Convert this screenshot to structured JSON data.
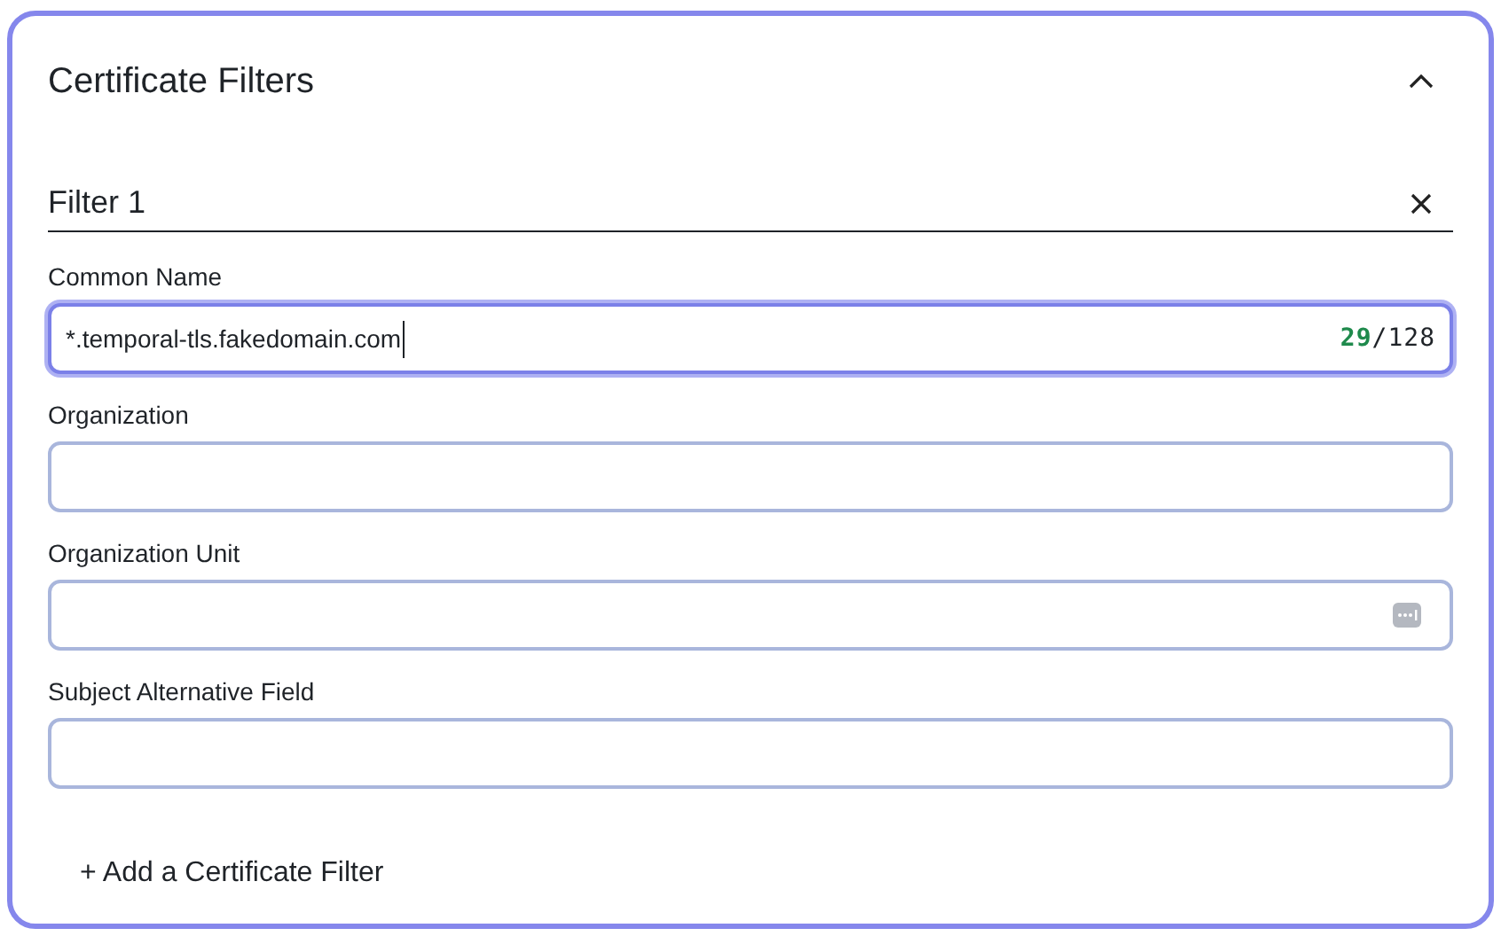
{
  "panel": {
    "title": "Certificate Filters",
    "expanded": true
  },
  "filter": {
    "title": "Filter 1"
  },
  "fields": [
    {
      "label": "Common Name",
      "value": "*.temporal-tls.fakedomain.com",
      "focused": true,
      "counter": {
        "count": "29",
        "limit": "/128"
      },
      "autofill_icon": false
    },
    {
      "label": "Organization",
      "focused": false,
      "autofill_icon": false
    },
    {
      "label": "Organization Unit",
      "focused": false,
      "autofill_icon": true
    },
    {
      "label": "Subject Alternative Field",
      "focused": false,
      "autofill_icon": false
    }
  ],
  "add_button": {
    "label": "+ Add a Certificate Filter"
  }
}
